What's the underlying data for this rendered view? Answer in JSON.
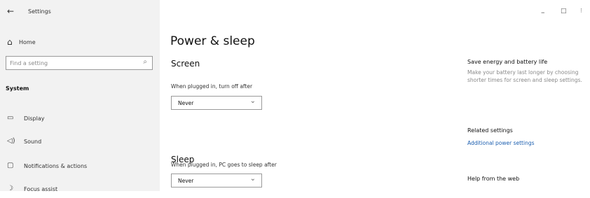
{
  "window": {
    "title": "Settings",
    "controls": {
      "minimize": "–",
      "maximize": "□",
      "close": "⁝"
    }
  },
  "sidebar": {
    "home_label": "Home",
    "search": {
      "placeholder": "Find a setting",
      "value": ""
    },
    "section_label": "System",
    "items": [
      {
        "label": "Display",
        "icon": "display-icon"
      },
      {
        "label": "Sound",
        "icon": "sound-icon"
      },
      {
        "label": "Notifications & actions",
        "icon": "notifications-icon"
      },
      {
        "label": "Focus assist",
        "icon": "focus-assist-icon"
      }
    ]
  },
  "main": {
    "title": "Power & sleep",
    "screen": {
      "heading": "Screen",
      "label": "When plugged in, turn off after",
      "value": "Never"
    },
    "sleep": {
      "heading": "Sleep",
      "label": "When plugged in, PC goes to sleep after",
      "value": "Never"
    }
  },
  "aside": {
    "tip_heading": "Save energy and battery life",
    "tip_text": "Make your battery last longer by choosing shorter times for screen and sleep settings.",
    "related_heading": "Related settings",
    "related_link": "Additional power settings",
    "help_heading": "Help from the web"
  }
}
